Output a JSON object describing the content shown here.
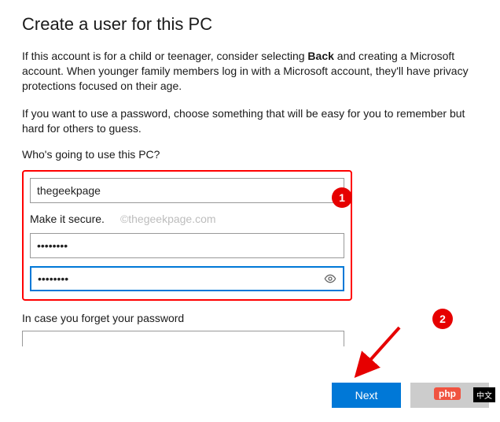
{
  "title": "Create a user for this PC",
  "intro_before_bold": "If this account is for a child or teenager, consider selecting ",
  "intro_bold": "Back",
  "intro_after_bold": " and creating a Microsoft account. When younger family members log in with a Microsoft account, they'll have privacy protections focused on their age.",
  "intro_password": "If you want to use a password, choose something that will be easy for you to remember but hard for others to guess.",
  "question": "Who's going to use this PC?",
  "username_value": "thegeekpage",
  "secure_label": "Make it secure.",
  "watermark": "©thegeekpage.com",
  "password_value": "••••••••",
  "confirm_value": "••••••••",
  "forgot_label": "In case you forget your password",
  "next_label": "Next",
  "php_badge": "php",
  "cn_badge": "中文",
  "callout_1": "1",
  "callout_2": "2"
}
